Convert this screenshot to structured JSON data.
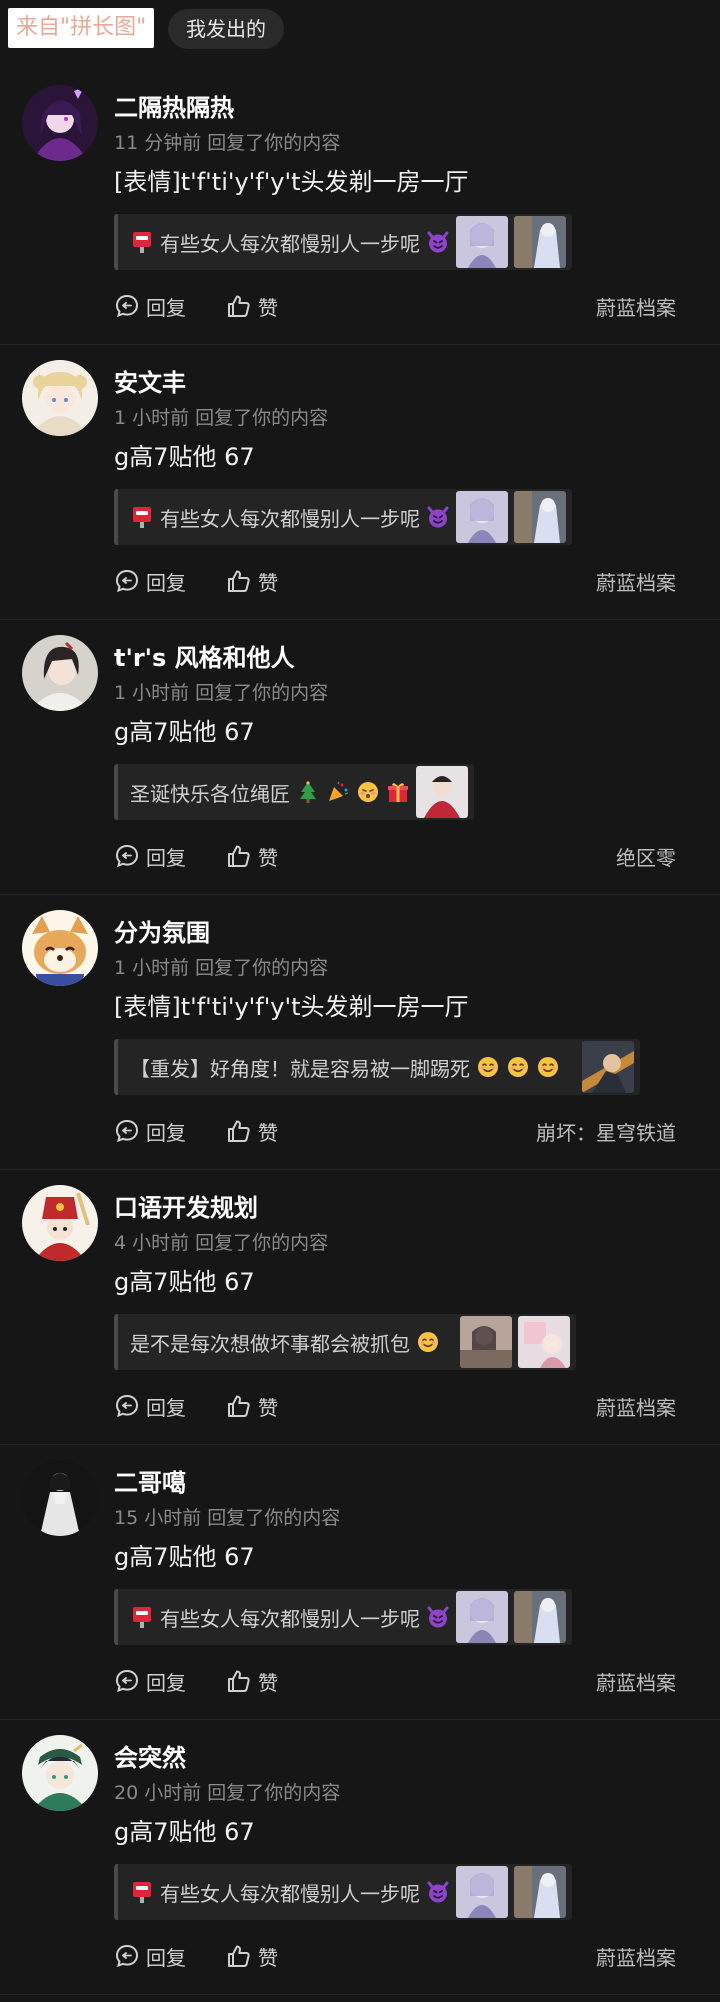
{
  "header": {
    "source_badge": "来自\"拼长图\"",
    "filter_tab": "我发出的"
  },
  "actions": {
    "reply_label": "回复",
    "like_label": "赞"
  },
  "notifications": [
    {
      "username": "二隔热隔热",
      "meta": "11 分钟前 回复了你的内容",
      "reply_text": "[表情]t'f'ti'y'f'y't头发剃一房一厅",
      "quote_text": "有些女人每次都慢别人一步呢",
      "source": "蔚蓝档案",
      "avatar": "purple-hair-character"
    },
    {
      "username": "安文丰",
      "meta": "1 小时前 回复了你的内容",
      "reply_text": "g高7贴他 67",
      "quote_text": "有些女人每次都慢别人一步呢",
      "source": "蔚蓝档案",
      "avatar": "blonde-character"
    },
    {
      "username": "t'r's 风格和他人",
      "meta": "1 小时前 回复了你的内容",
      "reply_text": "g高7贴他 67",
      "quote_text": "圣诞快乐各位绳匠",
      "source": "绝区零",
      "avatar": "dark-hair-girl"
    },
    {
      "username": "分为氛围",
      "meta": "1 小时前 回复了你的内容",
      "reply_text": "[表情]t'f'ti'y'f'y't头发剃一房一厅",
      "quote_text": "【重发】好角度！就是容易被一脚踢死",
      "source": "崩坏：星穹铁道",
      "avatar": "shiba-dog"
    },
    {
      "username": "口语开发规划",
      "meta": "4 小时前 回复了你的内容",
      "reply_text": "g高7贴他 67",
      "quote_text": "是不是每次想做坏事都会被抓包",
      "source": "蔚蓝档案",
      "avatar": "red-hat-character"
    },
    {
      "username": "二哥噶",
      "meta": "15 小时前 回复了你的内容",
      "reply_text": "g高7贴他 67",
      "quote_text": "有些女人每次都慢别人一步呢",
      "source": "蔚蓝档案",
      "avatar": "white-dress-figure"
    },
    {
      "username": "会突然",
      "meta": "20 小时前 回复了你的内容",
      "reply_text": "g高7贴他 67",
      "quote_text": "有些女人每次都慢别人一步呢",
      "source": "蔚蓝档案",
      "avatar": "green-bard-character"
    }
  ],
  "colors": {
    "background": "#161616",
    "quote_background": "#242424",
    "meta_text": "#8a8a8a",
    "badge_text": "#e8a898"
  }
}
